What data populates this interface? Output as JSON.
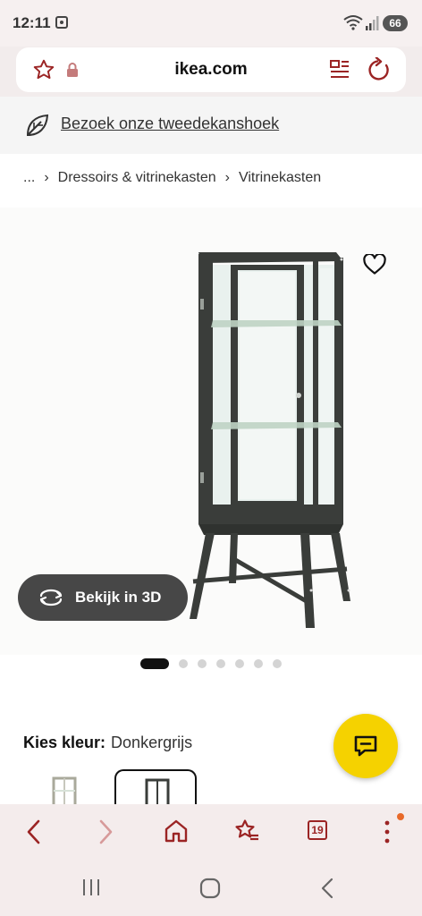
{
  "status": {
    "time": "12:11",
    "battery": "66"
  },
  "browser": {
    "domain": "ikea.com",
    "tab_count": "19"
  },
  "banner": {
    "link_text": "Bezoek onze tweedekanshoek"
  },
  "breadcrumb": {
    "ellipsis": "...",
    "items": [
      "Dressoirs & vitrinekasten",
      "Vitrinekasten"
    ]
  },
  "gallery": {
    "view_3d_label": "Bekijk in 3D",
    "image_count": 7,
    "active_index": 0
  },
  "color": {
    "label": "Kies kleur:",
    "value": "Donkergrijs"
  },
  "icons": {
    "accent": "#9b2424",
    "fab": "#f5d200"
  }
}
